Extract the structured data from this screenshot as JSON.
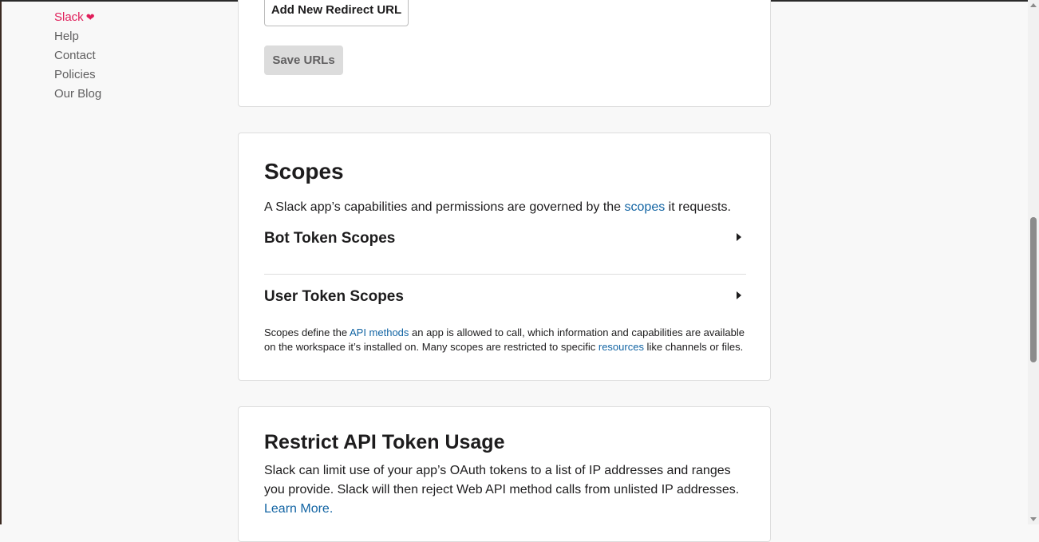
{
  "sidebar": {
    "links": [
      {
        "label": "Slack",
        "icon": "heart-icon"
      },
      {
        "label": "Help"
      },
      {
        "label": "Contact"
      },
      {
        "label": "Policies"
      },
      {
        "label": "Our Blog"
      }
    ]
  },
  "redirect_card": {
    "add_button": "Add New Redirect URL",
    "save_button": "Save URLs"
  },
  "scopes_card": {
    "title": "Scopes",
    "intro_before": "A Slack app’s capabilities and permissions are governed by the ",
    "intro_link": "scopes",
    "intro_after": " it requests.",
    "bot_title": "Bot Token Scopes",
    "user_title": "User Token Scopes",
    "note_part1": "Scopes define the ",
    "note_link1": "API methods",
    "note_part2": " an app is allowed to call, which information and capabilities are available on the workspace it’s installed on. Many scopes are restricted to specific ",
    "note_link2": "resources",
    "note_part3": " like channels or files."
  },
  "restrict_card": {
    "title": "Restrict API Token Usage",
    "desc": "Slack can limit use of your app’s OAuth tokens to a list of IP addresses and ranges you provide. Slack will then reject Web API method calls from unlisted IP addresses. ",
    "link": "Learn More."
  },
  "colors": {
    "slack_accent": "#e01e5a",
    "link_blue": "#1264a3",
    "text": "#1d1c1d",
    "muted": "#616061"
  }
}
